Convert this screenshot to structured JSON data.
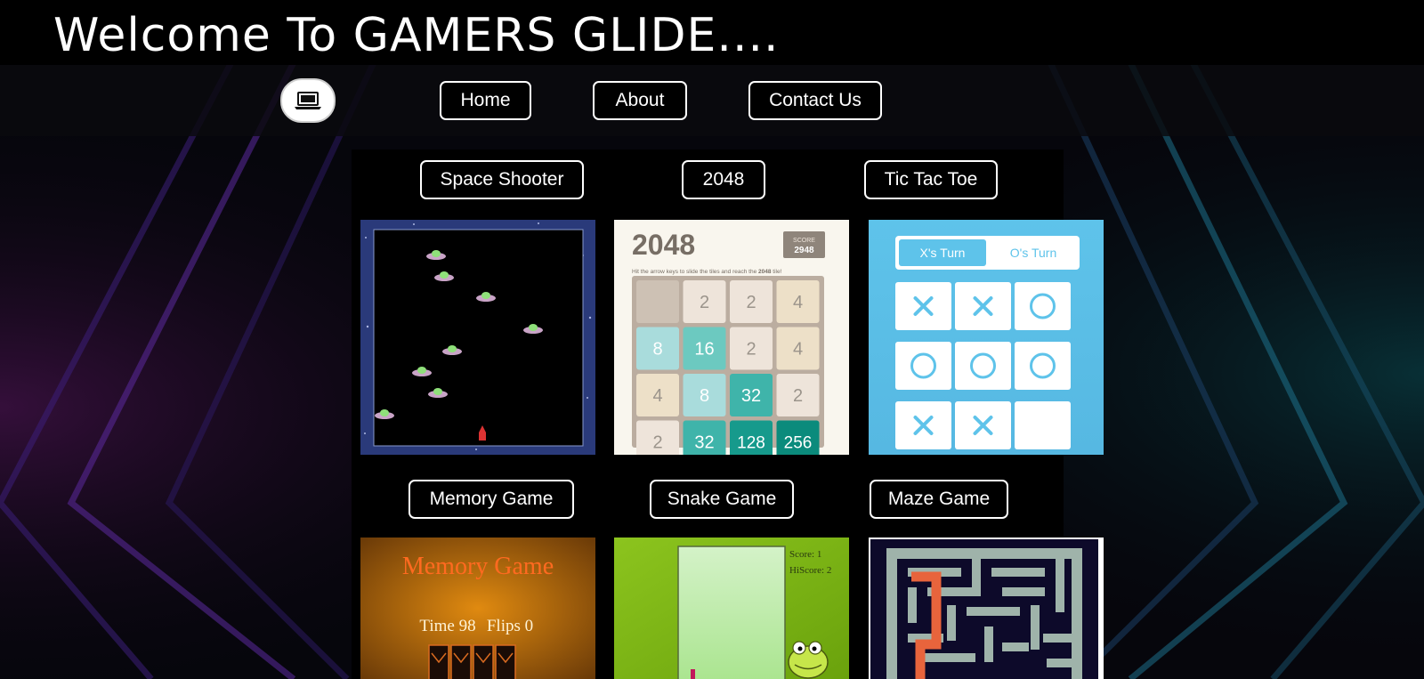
{
  "header": {
    "title": "Welcome To GAMERS GLIDE...."
  },
  "nav": {
    "logo_icon": "laptop-icon",
    "items": [
      {
        "label": "Home"
      },
      {
        "label": "About"
      },
      {
        "label": "Contact Us"
      }
    ]
  },
  "games": [
    {
      "label": "Space Shooter"
    },
    {
      "label": "2048"
    },
    {
      "label": "Tic Tac Toe"
    },
    {
      "label": "Memory Game"
    },
    {
      "label": "Snake Game"
    },
    {
      "label": "Maze Game"
    }
  ],
  "thumb_2048": {
    "title": "2048",
    "score_label": "SCORE",
    "score_value": "2948",
    "hint_prefix": "Hit the arrow keys to slide the tiles and reach the ",
    "hint_bold": "2048",
    "hint_suffix": " tile!",
    "tiles": [
      "",
      "2",
      "2",
      "4",
      "8",
      "16",
      "2",
      "4",
      "4",
      "8",
      "32",
      "2",
      "2",
      "32",
      "128",
      "256"
    ]
  },
  "thumb_tictactoe": {
    "x_turn": "X's Turn",
    "o_turn": "O's Turn",
    "cells": [
      "x",
      "x",
      "o",
      "o",
      "o",
      "o",
      "x",
      "x",
      ""
    ]
  },
  "thumb_memory": {
    "title": "Memory Game",
    "time_label": "Time 98",
    "flips_label": "Flips 0"
  },
  "thumb_snake": {
    "score_label": "Score: 1",
    "hiscore_label": "HiScore: 2"
  },
  "colors": {
    "accent_purple": "#5b2a9e",
    "accent_teal": "#1e6f8a",
    "tile_teal_dark": "#17a298",
    "tictactoe_blue": "#5ec3ea"
  }
}
